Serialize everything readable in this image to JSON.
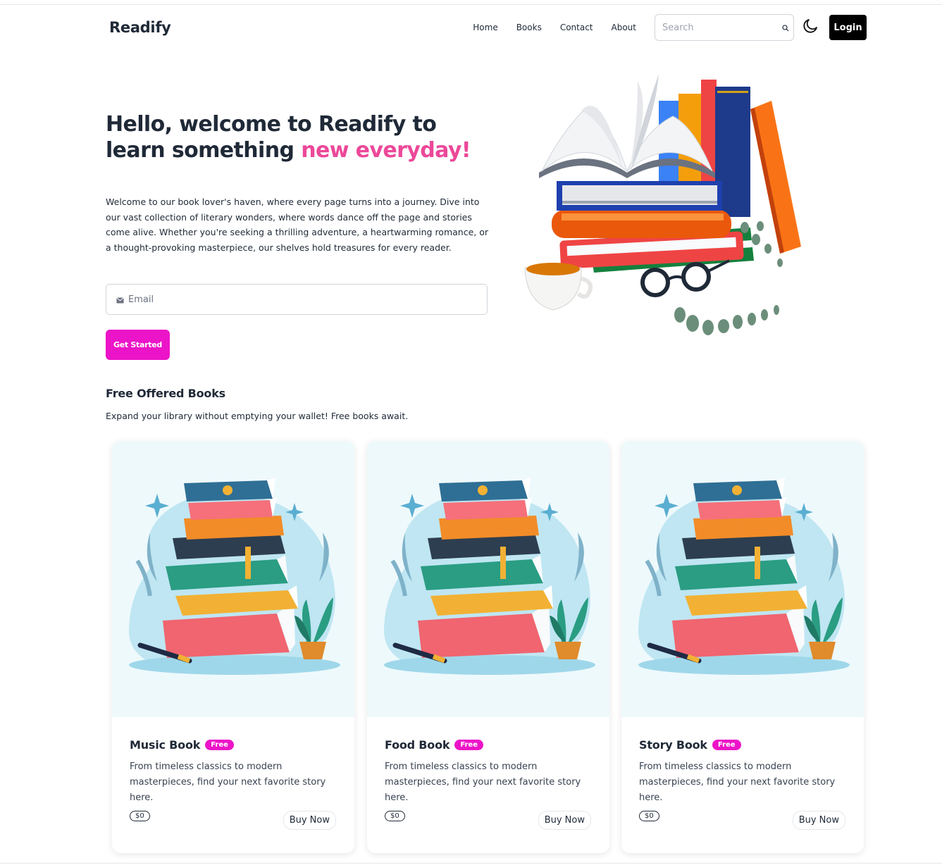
{
  "header": {
    "logo": "Readify",
    "nav_links": [
      "Home",
      "Books",
      "Contact",
      "About"
    ],
    "search_placeholder": "Search",
    "login_label": "Login"
  },
  "hero": {
    "title_part1": "Hello, welcome to Readify to learn something ",
    "title_accent": "new everyday!",
    "description": "Welcome to our book lover's haven, where every page turns into a journey. Dive into our vast collection of literary wonders, where words dance off the page and stories come alive. Whether you're seeking a thrilling adventure, a heartwarming romance, or a thought-provoking masterpiece, our shelves hold treasures for every reader.",
    "email_placeholder": "Email",
    "cta_label": "Get Started"
  },
  "free_books": {
    "title": "Free Offered Books",
    "subtitle": "Expand your library without emptying your wallet! Free books await.",
    "cards": [
      {
        "title": "Music Book",
        "badge": "Free",
        "description": "From timeless classics to modern masterpieces, find your next favorite story here.",
        "price": "$0",
        "button": "Buy Now"
      },
      {
        "title": "Food Book",
        "badge": "Free",
        "description": "From timeless classics to modern masterpieces, find your next favorite story here.",
        "price": "$0",
        "button": "Buy Now"
      },
      {
        "title": "Story Book",
        "badge": "Free",
        "description": "From timeless classics to modern masterpieces, find your next favorite story here.",
        "price": "$0",
        "button": "Buy Now"
      }
    ]
  },
  "icons": {
    "search": "search-icon",
    "theme": "moon-icon",
    "email": "envelope-icon"
  },
  "colors": {
    "accent_pink": "#ec4899",
    "button_magenta": "#ec14c8",
    "login_black": "#000000",
    "card_image_bg": "#eef9fc"
  }
}
